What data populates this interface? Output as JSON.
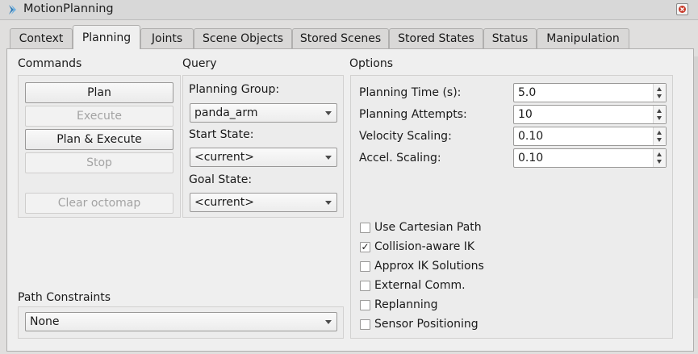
{
  "window": {
    "title": "MotionPlanning"
  },
  "tabs": [
    {
      "label": "Context",
      "active": false
    },
    {
      "label": "Planning",
      "active": true
    },
    {
      "label": "Joints",
      "active": false
    },
    {
      "label": "Scene Objects",
      "active": false
    },
    {
      "label": "Stored Scenes",
      "active": false
    },
    {
      "label": "Stored States",
      "active": false
    },
    {
      "label": "Status",
      "active": false
    },
    {
      "label": "Manipulation",
      "active": false
    }
  ],
  "commands": {
    "label": "Commands",
    "buttons": [
      {
        "label": "Plan",
        "enabled": true
      },
      {
        "label": "Execute",
        "enabled": false
      },
      {
        "label": "Plan & Execute",
        "enabled": true
      },
      {
        "label": "Stop",
        "enabled": false
      },
      {
        "label": "Clear octomap",
        "enabled": false
      }
    ]
  },
  "query": {
    "label": "Query",
    "planning_group_label": "Planning Group:",
    "planning_group_value": "panda_arm",
    "start_state_label": "Start State:",
    "start_state_value": "<current>",
    "goal_state_label": "Goal State:",
    "goal_state_value": "<current>"
  },
  "options": {
    "label": "Options",
    "fields": [
      {
        "label": "Planning Time (s):",
        "value": "5.0"
      },
      {
        "label": "Planning Attempts:",
        "value": "10"
      },
      {
        "label": "Velocity Scaling:",
        "value": "0.10"
      },
      {
        "label": "Accel. Scaling:",
        "value": "0.10"
      }
    ],
    "checkboxes": [
      {
        "label": "Use Cartesian Path",
        "checked": false
      },
      {
        "label": "Collision-aware IK",
        "checked": true
      },
      {
        "label": "Approx IK Solutions",
        "checked": false
      },
      {
        "label": "External Comm.",
        "checked": false
      },
      {
        "label": "Replanning",
        "checked": false
      },
      {
        "label": "Sensor Positioning",
        "checked": false
      }
    ]
  },
  "path_constraints": {
    "label": "Path Constraints",
    "value": "None"
  },
  "icons": {
    "app": "rviz-plugin-icon",
    "close": "close-icon",
    "check": "✓"
  },
  "colors": {
    "window_bg": "#efefef",
    "tab_bg": "#d9d8d7",
    "disabled_text": "#a3a3a3"
  }
}
